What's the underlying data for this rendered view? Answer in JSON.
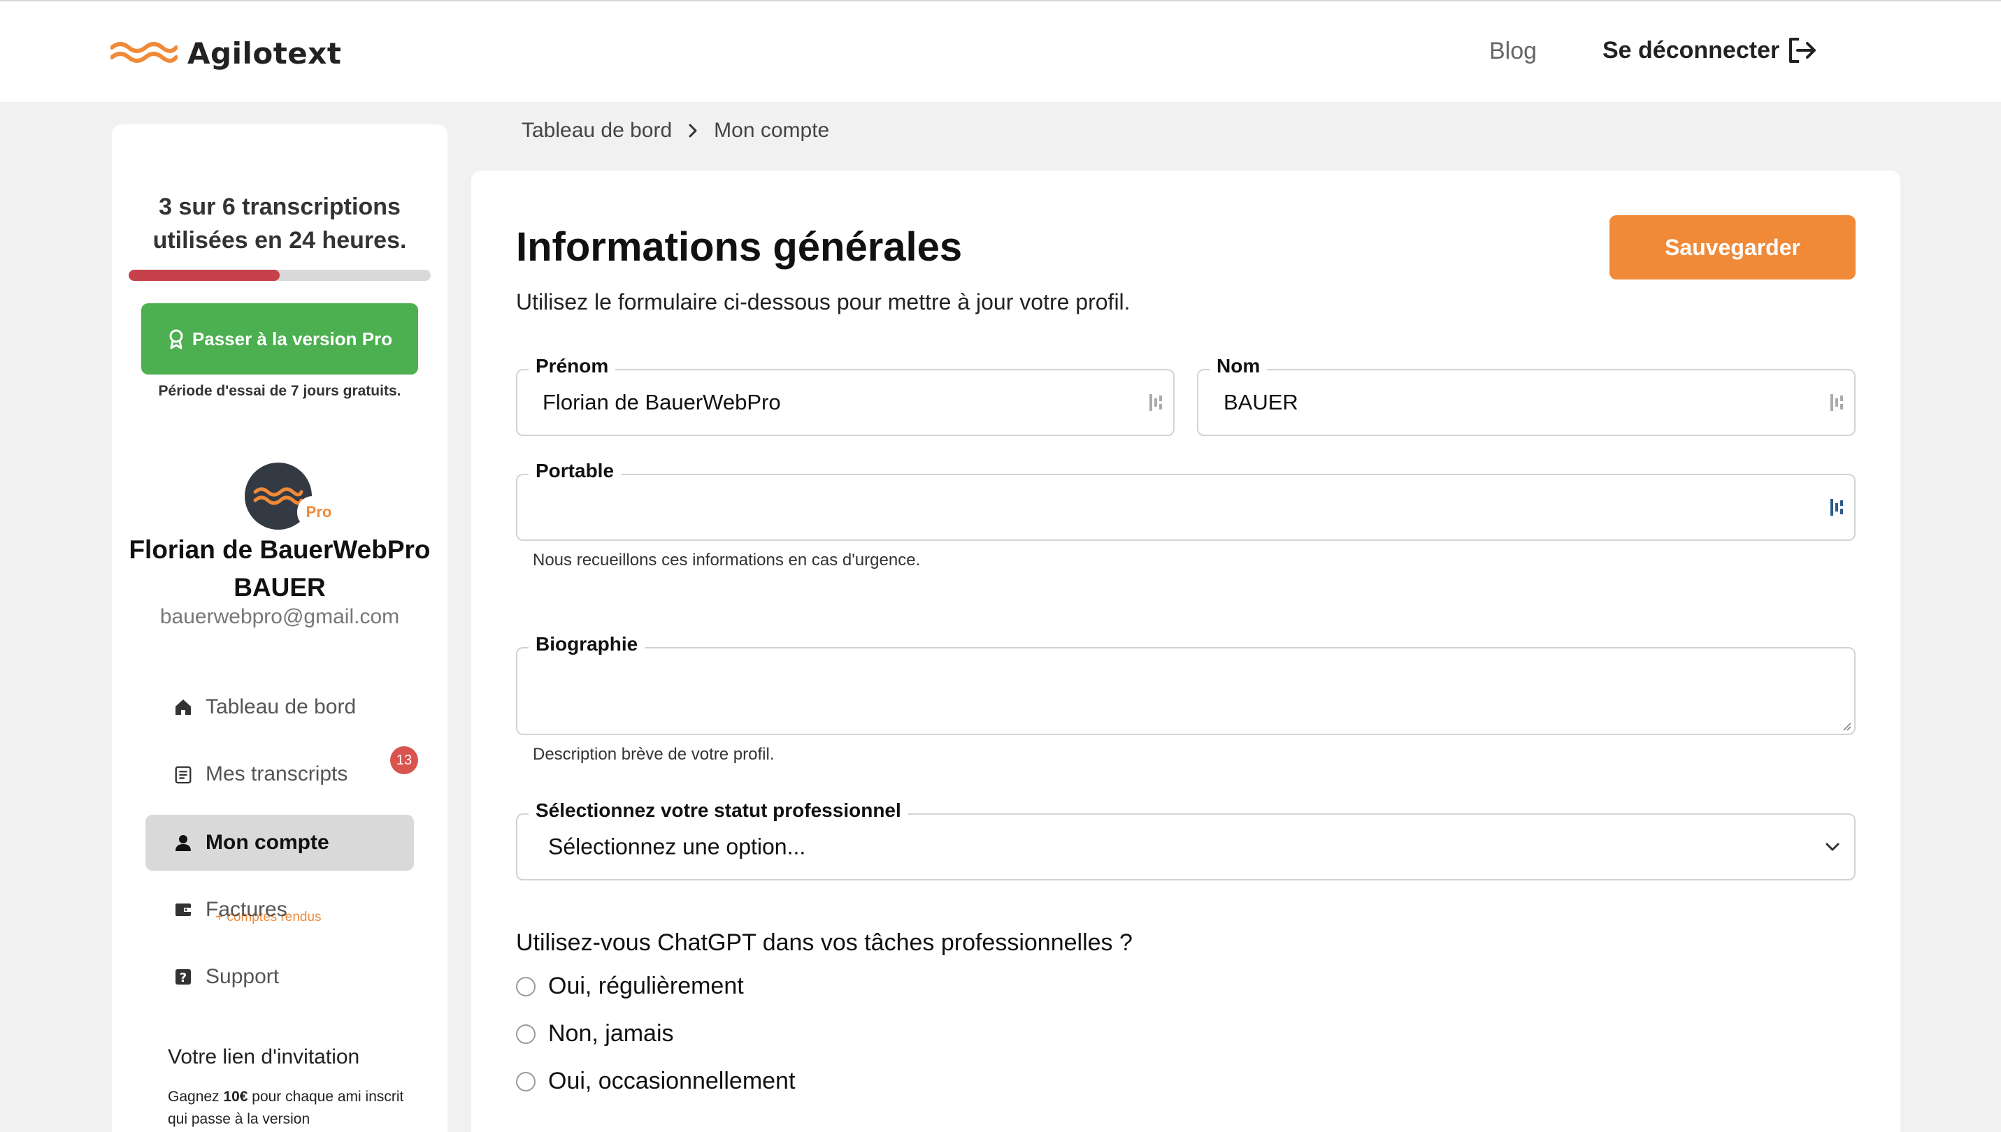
{
  "header": {
    "brand": "Agilotext",
    "nav": {
      "blog": "Blog",
      "logout": "Se déconnecter"
    }
  },
  "sidebar": {
    "quota_line1": "3 sur 6 transcriptions",
    "quota_line2": "utilisées en 24 heures.",
    "quota_used": 3,
    "quota_total": 6,
    "pro_button": "Passer à la version Pro",
    "trial_note": "Période d'essai de 7 jours gratuits.",
    "avatar_badge": "Pro",
    "user_first": "Florian de BauerWebPro",
    "user_last": "BAUER",
    "user_email": "bauerwebpro@gmail.com",
    "menu": [
      {
        "label": "Tableau de bord",
        "icon": "home-icon"
      },
      {
        "label": "Mes transcripts",
        "icon": "transcripts-icon",
        "badge": "13",
        "sublabel": "+ comptes rendus"
      },
      {
        "label": "Mon compte",
        "icon": "user-icon",
        "active": true
      },
      {
        "label": "Factures",
        "icon": "wallet-icon"
      },
      {
        "label": "Support",
        "icon": "help-icon"
      }
    ],
    "invite_title": "Votre lien d'invitation",
    "invite_text_pre": "Gagnez ",
    "invite_amount": "10€",
    "invite_text_post": " pour chaque ami inscrit qui passe à la version"
  },
  "breadcrumb": {
    "root": "Tableau de bord",
    "current": "Mon compte"
  },
  "form": {
    "title": "Informations générales",
    "subtitle": "Utilisez le formulaire ci-dessous pour mettre à jour votre profil.",
    "save": "Sauvegarder",
    "prenom_label": "Prénom",
    "prenom_value": "Florian de BauerWebPro",
    "nom_label": "Nom",
    "nom_value": "BAUER",
    "portable_label": "Portable",
    "portable_value": "",
    "portable_help": "Nous recueillons ces informations en cas d'urgence.",
    "bio_label": "Biographie",
    "bio_value": "",
    "bio_help": "Description brève de votre profil.",
    "status_label": "Sélectionnez votre statut professionnel",
    "status_value": "Sélectionnez une option...",
    "question": "Utilisez-vous ChatGPT dans vos tâches professionnelles ?",
    "options": [
      "Oui, régulièrement",
      "Non, jamais",
      "Oui, occasionnellement"
    ]
  },
  "colors": {
    "accent": "#f08a38",
    "pro_green": "#4caf50",
    "progress_red": "#c6414a",
    "badge_red": "#d9534f"
  }
}
